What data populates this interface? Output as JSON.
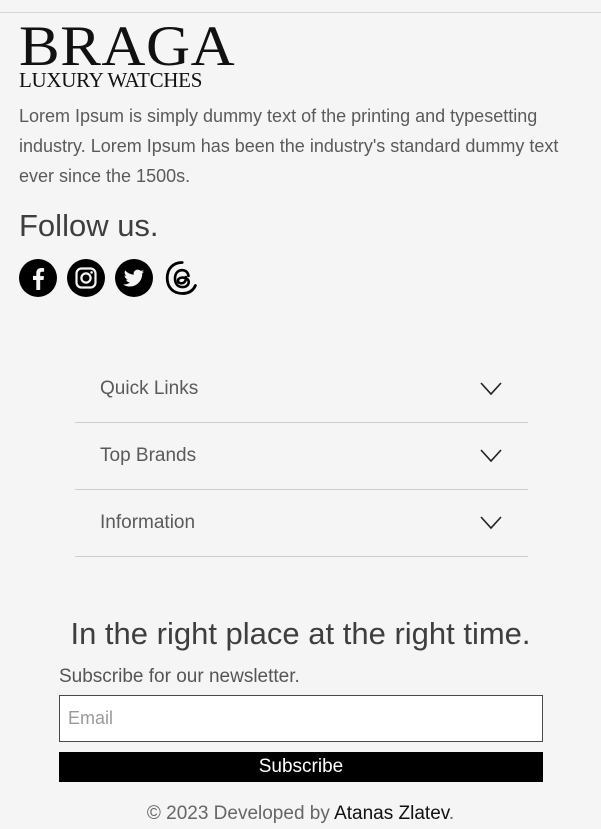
{
  "brand": {
    "name": "BRAGA",
    "subtitle": "LUXURY WATCHES"
  },
  "about": {
    "text": "Lorem Ipsum is simply dummy text of the printing and typesetting industry. Lorem Ipsum has been the industry's standard dummy text ever since the 1500s."
  },
  "follow": {
    "heading": "Follow us.",
    "icons": [
      "facebook-icon",
      "instagram-icon",
      "twitter-icon",
      "threads-icon"
    ]
  },
  "accordion": {
    "items": [
      {
        "label": "Quick Links"
      },
      {
        "label": "Top Brands"
      },
      {
        "label": "Information"
      }
    ]
  },
  "newsletter": {
    "tagline": "In the right place at the right time.",
    "label": "Subscribe for our newsletter.",
    "email_placeholder": "Email",
    "button_label": "Subscribe"
  },
  "footer": {
    "prefix": "© 2023 Developed by ",
    "author": "Atanas Zlatev",
    "suffix": "."
  },
  "colors": {
    "background": "#f5f5f5",
    "text": "#3a3a3a",
    "button": "#000000",
    "divider": "#cdcdcd"
  }
}
